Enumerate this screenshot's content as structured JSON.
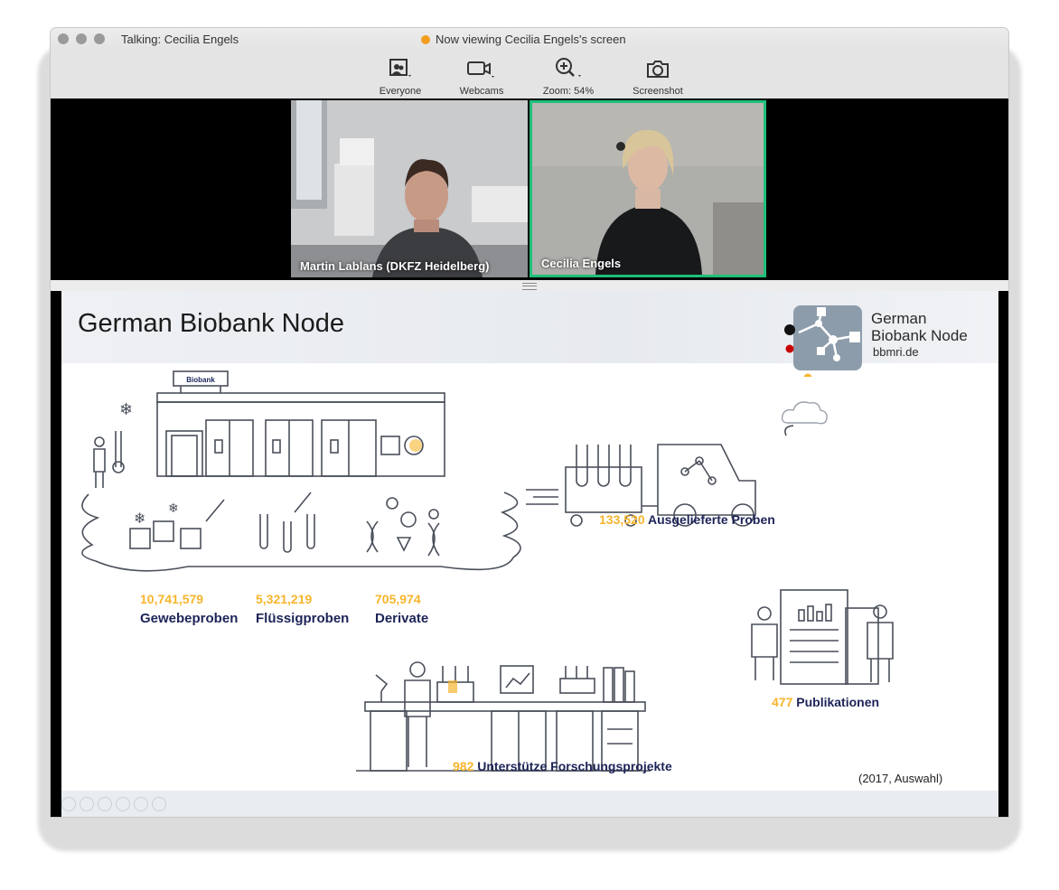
{
  "window": {
    "talking": "Talking: Cecilia Engels",
    "viewing": "Now viewing Cecilia Engels's screen"
  },
  "toolbar": {
    "everyone": "Everyone",
    "webcams": "Webcams",
    "zoom": "Zoom: 54%",
    "screenshot": "Screenshot"
  },
  "participants": [
    {
      "name": "Martin Lablans (DKFZ Heidelberg)"
    },
    {
      "name": "Cecilia Engels"
    }
  ],
  "slide": {
    "title": "German Biobank Node",
    "logo": {
      "line1": "German",
      "line2": "Biobank Node",
      "url": "bbmri.de"
    },
    "biobank_sign": "Biobank",
    "stats": {
      "gewebe": {
        "value": "10,741,579",
        "label": "Gewebeproben"
      },
      "fluessig": {
        "value": "5,321,219",
        "label": "Flüssigproben"
      },
      "derivate": {
        "value": "705,974",
        "label": "Derivate"
      },
      "ausgeliefert": {
        "value": "133,520",
        "label": "Ausgelieferte Proben"
      },
      "publikationen": {
        "value": "477",
        "label": "Publikationen"
      },
      "projekte": {
        "value": "982",
        "label": "Unterstütze Forschungsprojekte"
      }
    },
    "note": "(2017, Auswahl)"
  },
  "colors": {
    "accent_yellow": "#f7b52d",
    "label_navy": "#1c2458",
    "active_speaker_border": "#1fbf7a",
    "logo_block": "#8d9cab"
  }
}
